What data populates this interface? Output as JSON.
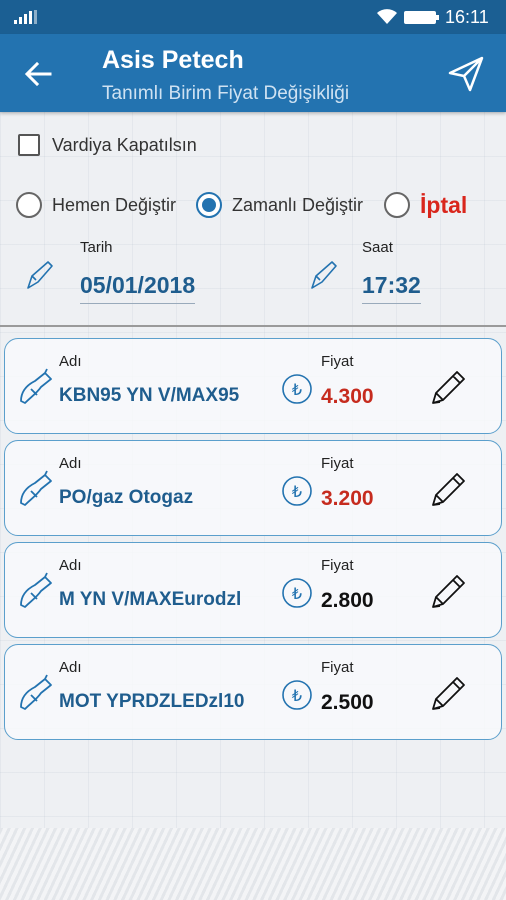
{
  "status_bar": {
    "time": "16:11"
  },
  "app_bar": {
    "title": "Asis Petech",
    "subtitle": "Tanımlı Birim Fiyat Değişikliği"
  },
  "options": {
    "checkbox_label": "Vardiya Kapatılsın",
    "checkbox_checked": false,
    "radio_immediate": "Hemen Değiştir",
    "radio_scheduled": "Zamanlı Değiştir",
    "radio_cancel": "İptal",
    "selected_radio": "Zamanlı Değiştir"
  },
  "schedule": {
    "date_label": "Tarih",
    "date_value": "05/01/2018",
    "time_label": "Saat",
    "time_value": "17:32"
  },
  "products": [
    {
      "name_label": "Adı",
      "name": "KBN95 YN V/MAX95",
      "price_label": "Fiyat",
      "price": "4.300",
      "price_changed": true
    },
    {
      "name_label": "Adı",
      "name": "PO/gaz Otogaz",
      "price_label": "Fiyat",
      "price": "3.200",
      "price_changed": true
    },
    {
      "name_label": "Adı",
      "name": "M YN V/MAXEurodzl",
      "price_label": "Fiyat",
      "price": "2.800",
      "price_changed": false
    },
    {
      "name_label": "Adı",
      "name": "MOT YPRDZLEDzl10",
      "price_label": "Fiyat",
      "price": "2.500",
      "price_changed": false
    }
  ],
  "colors": {
    "status_bar": "#1b5f93",
    "app_bar": "#2373b0",
    "accent_text": "#1f5d8e",
    "changed_price": "#c62b1e",
    "cancel": "#d9261c"
  }
}
